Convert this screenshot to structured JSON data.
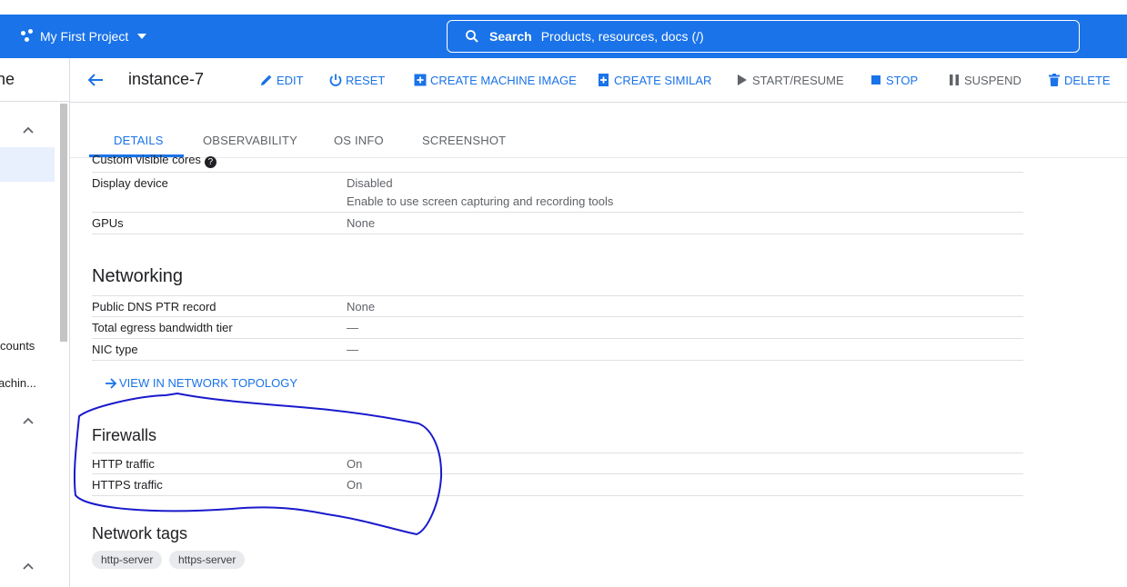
{
  "appbar": {
    "project_name": "My First Project",
    "search_label": "Search",
    "search_placeholder": "Products, resources, docs (/)"
  },
  "sidebar": {
    "title_fragment": "ne",
    "items": [
      "counts",
      "achin..."
    ]
  },
  "header": {
    "instance_name": "instance-7",
    "actions": {
      "edit": "EDIT",
      "reset": "RESET",
      "create_machine_image": "CREATE MACHINE IMAGE",
      "create_similar": "CREATE SIMILAR",
      "start_resume": "START/RESUME",
      "stop": "STOP",
      "suspend": "SUSPEND",
      "delete": "DELETE"
    }
  },
  "tabs": [
    "DETAILS",
    "OBSERVABILITY",
    "OS INFO",
    "SCREENSHOT"
  ],
  "details": {
    "custom_visible_cores_label": "Custom visible cores",
    "display_device": {
      "label": "Display device",
      "value": "Disabled",
      "note": "Enable to use screen capturing and recording tools"
    },
    "gpus": {
      "label": "GPUs",
      "value": "None"
    }
  },
  "networking": {
    "title": "Networking",
    "rows": [
      {
        "label": "Public DNS PTR record",
        "value": "None"
      },
      {
        "label": "Total egress bandwidth tier",
        "value": "—"
      },
      {
        "label": "NIC type",
        "value": "—"
      }
    ],
    "topology_link": "VIEW IN NETWORK TOPOLOGY"
  },
  "firewalls": {
    "title": "Firewalls",
    "rows": [
      {
        "label": "HTTP traffic",
        "value": "On"
      },
      {
        "label": "HTTPS traffic",
        "value": "On"
      }
    ]
  },
  "network_tags": {
    "title": "Network tags",
    "tags": [
      "http-server",
      "https-server"
    ]
  },
  "colors": {
    "appbar": "#1a73e8",
    "accent": "#1a73e8",
    "annotation": "#1a1acc"
  }
}
